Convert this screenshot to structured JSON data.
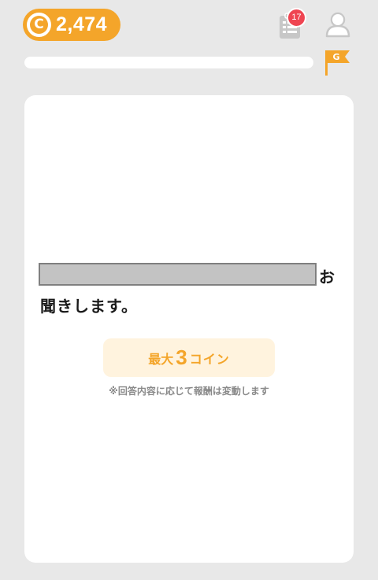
{
  "header": {
    "coin_balance": "2,474",
    "coin_symbol": "C",
    "notification_count": "17",
    "goal_flag_letter": "G",
    "progress": 0
  },
  "question": {
    "suffix": "お",
    "line2": "聞きします。"
  },
  "reward": {
    "prefix": "最大",
    "amount": "3",
    "suffix": "コイン",
    "note": "※回答内容に応じて報酬は変動します"
  },
  "colors": {
    "background": "#e8e8e8",
    "accent_orange": "#f4a52a",
    "badge_red": "#ef4552",
    "reward_bg": "#fff3de"
  },
  "icons": {
    "coin": "coin-icon",
    "clipboard": "clipboard-icon",
    "profile": "profile-icon",
    "flag": "goal-flag-icon"
  }
}
